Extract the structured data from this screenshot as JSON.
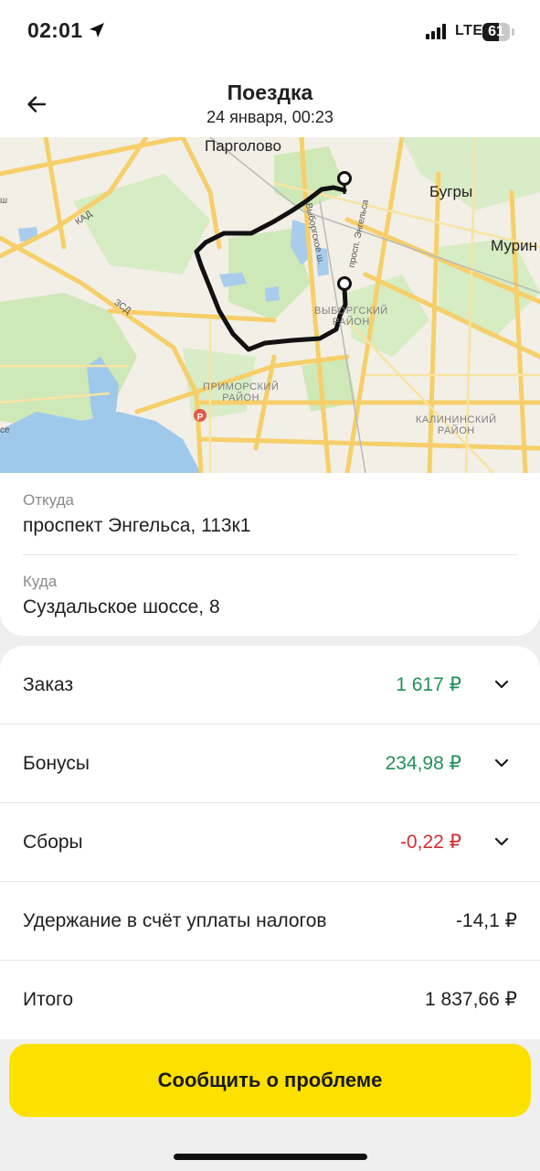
{
  "status_bar": {
    "time": "02:01",
    "network": "LTE",
    "battery": "61",
    "battery_level": 0.61,
    "location_icon": "location-arrow-icon",
    "signal_icon": "cellular-signal-icon"
  },
  "header": {
    "back_icon": "arrow-left-icon",
    "title": "Поездка",
    "subtitle": "24 января, 00:23"
  },
  "map": {
    "labels": {
      "pargolovo": "Парголово",
      "bugry": "Бугры",
      "murino": "Мурин",
      "kad": "КАД",
      "zsd": "ЗСД",
      "vyborgskoe": "Выборгское ш.",
      "engelsa": "просп. Энгельса",
      "vyborgsky_district": "ВЫБОРГСКИЙ\nРАЙОН",
      "primorsky_district": "ПРИМОРСКИЙ\nРАЙОН",
      "kalininsky_district": "КАЛИНИНСКИЙ\nРАЙОН",
      "shosse_left": "ш",
      "shosse_left2": "се"
    },
    "markers": [
      "pin-icon",
      "pin-icon",
      "parking-icon"
    ]
  },
  "route": {
    "from_label": "Откуда",
    "from": "проспект Энгельса, 113к1",
    "to_label": "Куда",
    "to": "Суздальское шоссе, 8"
  },
  "finance": {
    "rows": [
      {
        "label": "Заказ",
        "amount": "1 617 ₽",
        "color": "#21915a",
        "expandable": true
      },
      {
        "label": "Бонусы",
        "amount": "234,98 ₽",
        "color": "#21915a",
        "expandable": true
      },
      {
        "label": "Сборы",
        "amount": "-0,22 ₽",
        "color": "#d0302f",
        "expandable": true
      },
      {
        "label": "Удержание в счёт уплаты налогов",
        "amount": "-14,1 ₽",
        "color": "#1f1f1f",
        "expandable": false
      },
      {
        "label": "Итого",
        "amount": "1 837,66 ₽",
        "color": "#1f1f1f",
        "expandable": false
      }
    ]
  },
  "actions": {
    "report_label": "Сообщить о проблеме",
    "report_color": "#fce000"
  }
}
